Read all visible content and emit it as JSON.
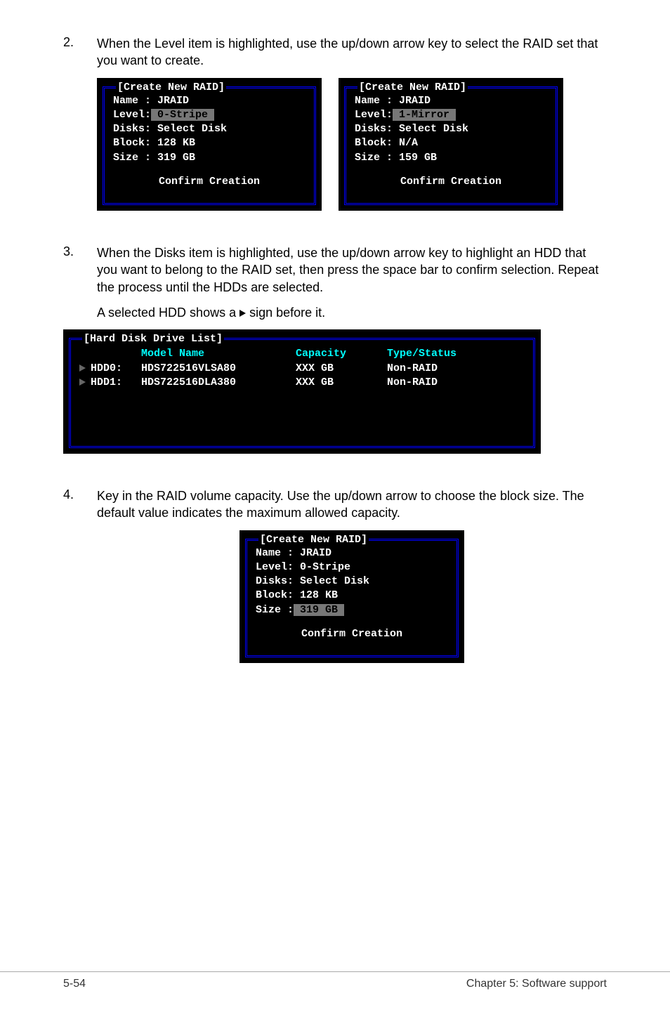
{
  "steps": {
    "s2": {
      "num": "2.",
      "text": "When the Level item is highlighted, use the up/down arrow key to select the RAID set that you want to create."
    },
    "s3": {
      "num": "3.",
      "text1": "When the Disks item is highlighted, use the up/down arrow key to highlight an HDD that you want to belong to the RAID set, then press the space bar to confirm selection. Repeat the process until the HDDs are selected.",
      "text2_a": "A selected HDD shows a ",
      "text2_b": " sign before it."
    },
    "s4": {
      "num": "4.",
      "text": "Key in the RAID volume capacity. Use the up/down arrow to choose the block size. The default value indicates the maximum allowed capacity."
    }
  },
  "panelA": {
    "title": "[Create New RAID]",
    "lines": {
      "name": "Name : JRAID",
      "level_k": "Level:",
      "level_v": " 0-Stripe ",
      "disks": "Disks: Select Disk",
      "block": "Block: 128 KB",
      "size": "Size : 319 GB"
    },
    "confirm": "Confirm Creation"
  },
  "panelB": {
    "title": "[Create New RAID]",
    "lines": {
      "name": "Name : JRAID",
      "level_k": "Level:",
      "level_v": " 1-Mirror ",
      "disks": "Disks: Select Disk",
      "block": "Block: N/A",
      "size": "Size : 159 GB"
    },
    "confirm": "Confirm Creation"
  },
  "panelHDD": {
    "title": "[Hard Disk Drive List]",
    "headers": {
      "model": "Model Name",
      "cap": "Capacity",
      "type": "Type/Status"
    },
    "rows": [
      {
        "id": "HDD0:",
        "model": "HDS722516VLSA80",
        "cap": "XXX GB",
        "type": "Non-RAID"
      },
      {
        "id": "HDD1:",
        "model": "HDS722516DLA380",
        "cap": "XXX GB",
        "type": "Non-RAID"
      }
    ]
  },
  "panelC": {
    "title": "[Create New RAID]",
    "lines": {
      "name": "Name : JRAID",
      "level": "Level: 0-Stripe",
      "disks": "Disks: Select Disk",
      "block": "Block: 128 KB",
      "size_k": "Size :",
      "size_v": " 319 GB "
    },
    "confirm": "Confirm Creation"
  },
  "footer": {
    "left": "5-54",
    "right": "Chapter 5: Software support"
  }
}
